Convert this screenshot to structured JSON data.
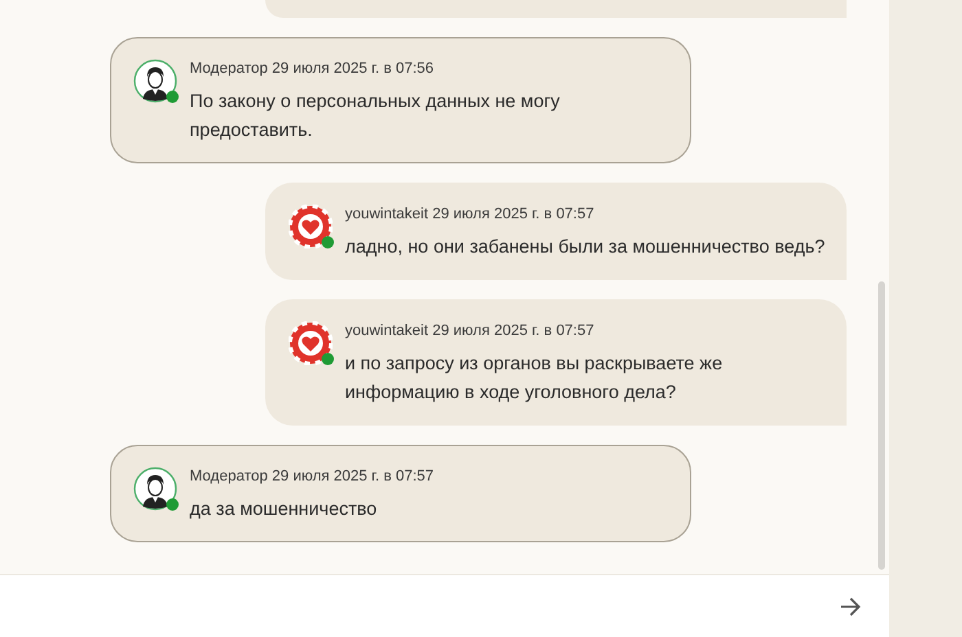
{
  "messages": [
    {
      "kind": "moderator",
      "author": "Модератор",
      "timestamp": "29 июля 2025 г. в 07:56",
      "text": "По закону о персональных данных не могу\nпредоставить.",
      "online": true
    },
    {
      "kind": "user",
      "author": "youwintakeit",
      "timestamp": "29 июля 2025 г. в 07:57",
      "text": "ладно, но они забанены были за мошенничество ведь?",
      "online": true
    },
    {
      "kind": "user",
      "author": "youwintakeit",
      "timestamp": "29 июля 2025 г. в 07:57",
      "text": "и по запросу из органов вы раскрываете же\nинформацию в ходе уголовного дела?",
      "online": true
    },
    {
      "kind": "moderator",
      "author": "Модератор",
      "timestamp": "29 июля 2025 г. в 07:57",
      "text": "да за мошенничество",
      "online": true
    }
  ]
}
